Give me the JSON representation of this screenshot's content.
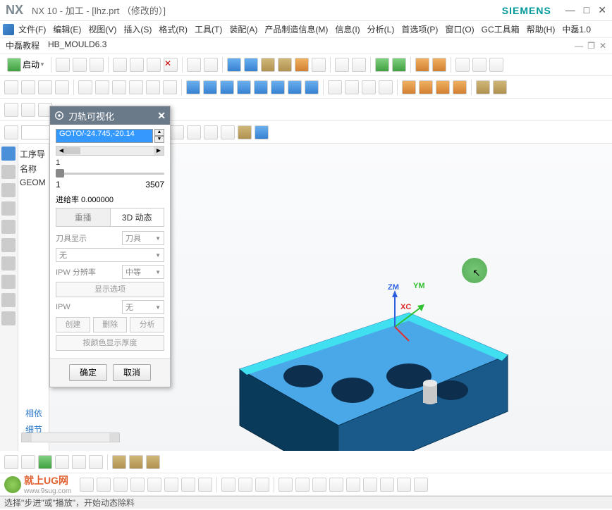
{
  "title": {
    "logo": "NX",
    "text": "NX 10 - 加工 - [lhz.prt （修改的）]",
    "brand": "SIEMENS"
  },
  "menubar": [
    "文件(F)",
    "编辑(E)",
    "视图(V)",
    "插入(S)",
    "格式(R)",
    "工具(T)",
    "装配(A)",
    "产品制造信息(M)",
    "信息(I)",
    "分析(L)",
    "首选项(P)",
    "窗口(O)",
    "GC工具箱",
    "帮助(H)",
    "中磊1.0"
  ],
  "subbar": {
    "items": [
      "中磊教程",
      "HB_MOULD6.3"
    ]
  },
  "toolbar1": {
    "start": "启动"
  },
  "tree": {
    "header": "工序导",
    "name_col": "名称",
    "root": "GEOM"
  },
  "dialog": {
    "title": "刀轨可视化",
    "goto_value": "GOTO/-24.745,-20.14",
    "slider1": {
      "label": "1",
      "min": "1",
      "max": "3507"
    },
    "feed_label": "进给率 0.000000",
    "tabs": [
      "重播",
      "3D 动态"
    ],
    "opts": {
      "tool_display_label": "刀具显示",
      "tool_display_value": "刀具",
      "none1": "无",
      "ipw_res_label": "IPW 分辨率",
      "ipw_res_value": "中等",
      "display_options": "显示选项",
      "ipw_label": "IPW",
      "ipw_value": "无",
      "create": "创建",
      "delete": "删除",
      "analyze": "分析",
      "color_thickness": "按颜色显示厚度"
    },
    "footer": {
      "ok": "确定",
      "cancel": "取消"
    }
  },
  "axes": {
    "zm": "ZM",
    "ym": "YM",
    "xc": "XC"
  },
  "bottom_tabs": [
    "相依",
    "细节"
  ],
  "statusbar": "选择\"步进\"或\"播放\"，开始动态除料",
  "watermark": {
    "text": "就上UG网",
    "url": "www.9sug.com"
  }
}
